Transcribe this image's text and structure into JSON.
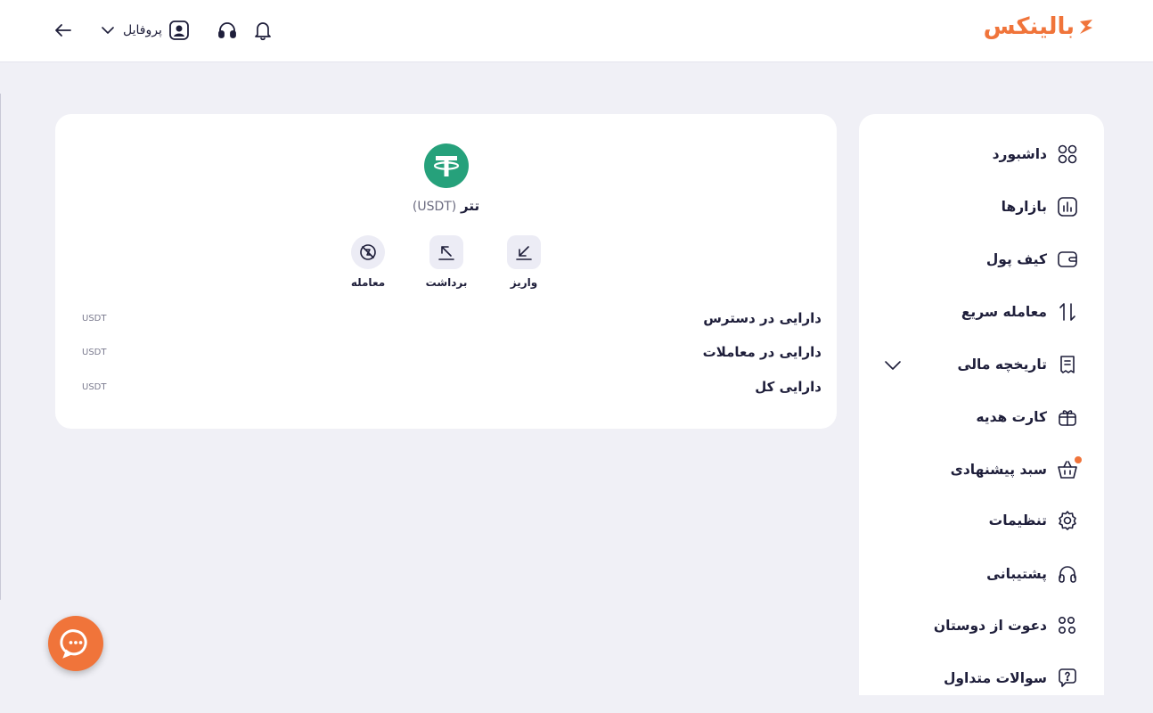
{
  "brand": {
    "name": "بالینکس",
    "color": "#f0743a"
  },
  "header": {
    "profile_label": "پروفایل",
    "icons": [
      "back-arrow-icon",
      "chevron-down-icon",
      "user-icon",
      "headset-icon",
      "bell-icon"
    ]
  },
  "asset": {
    "name": "تتر",
    "symbol": "(USDT)",
    "icon": "tether-icon",
    "icon_color": "#26a17b",
    "actions": [
      {
        "label": "واریز",
        "icon": "deposit-arrow-icon"
      },
      {
        "label": "برداشت",
        "icon": "withdraw-arrow-icon"
      },
      {
        "label": "معامله",
        "icon": "trade-icon"
      }
    ],
    "balances": [
      {
        "label": "دارایی در دسترس",
        "unit": "USDT"
      },
      {
        "label": "دارایی در معاملات",
        "unit": "USDT"
      },
      {
        "label": "دارایی کل",
        "unit": "USDT"
      }
    ]
  },
  "sidebar": {
    "items": [
      {
        "label": "داشبورد",
        "icon": "dashboard-icon"
      },
      {
        "label": "بازارها",
        "icon": "markets-icon"
      },
      {
        "label": "کیف پول",
        "icon": "wallet-icon"
      },
      {
        "label": "معامله سریع",
        "icon": "swap-icon"
      },
      {
        "label": "تاریخچه مالی",
        "icon": "history-icon",
        "expandable": true
      },
      {
        "label": "کارت هدیه",
        "icon": "gift-icon"
      },
      {
        "label": "سبد پیشنهادی",
        "icon": "basket-icon",
        "badge_dot": true
      },
      {
        "label": "تنظیمات",
        "icon": "settings-icon"
      },
      {
        "label": "پشتیبانی",
        "icon": "headset-icon"
      },
      {
        "label": "دعوت از دوستان",
        "icon": "invite-icon"
      },
      {
        "label": "سوالات متداول",
        "icon": "faq-icon"
      }
    ]
  },
  "chat": {
    "icon": "chat-bubble-icon"
  }
}
